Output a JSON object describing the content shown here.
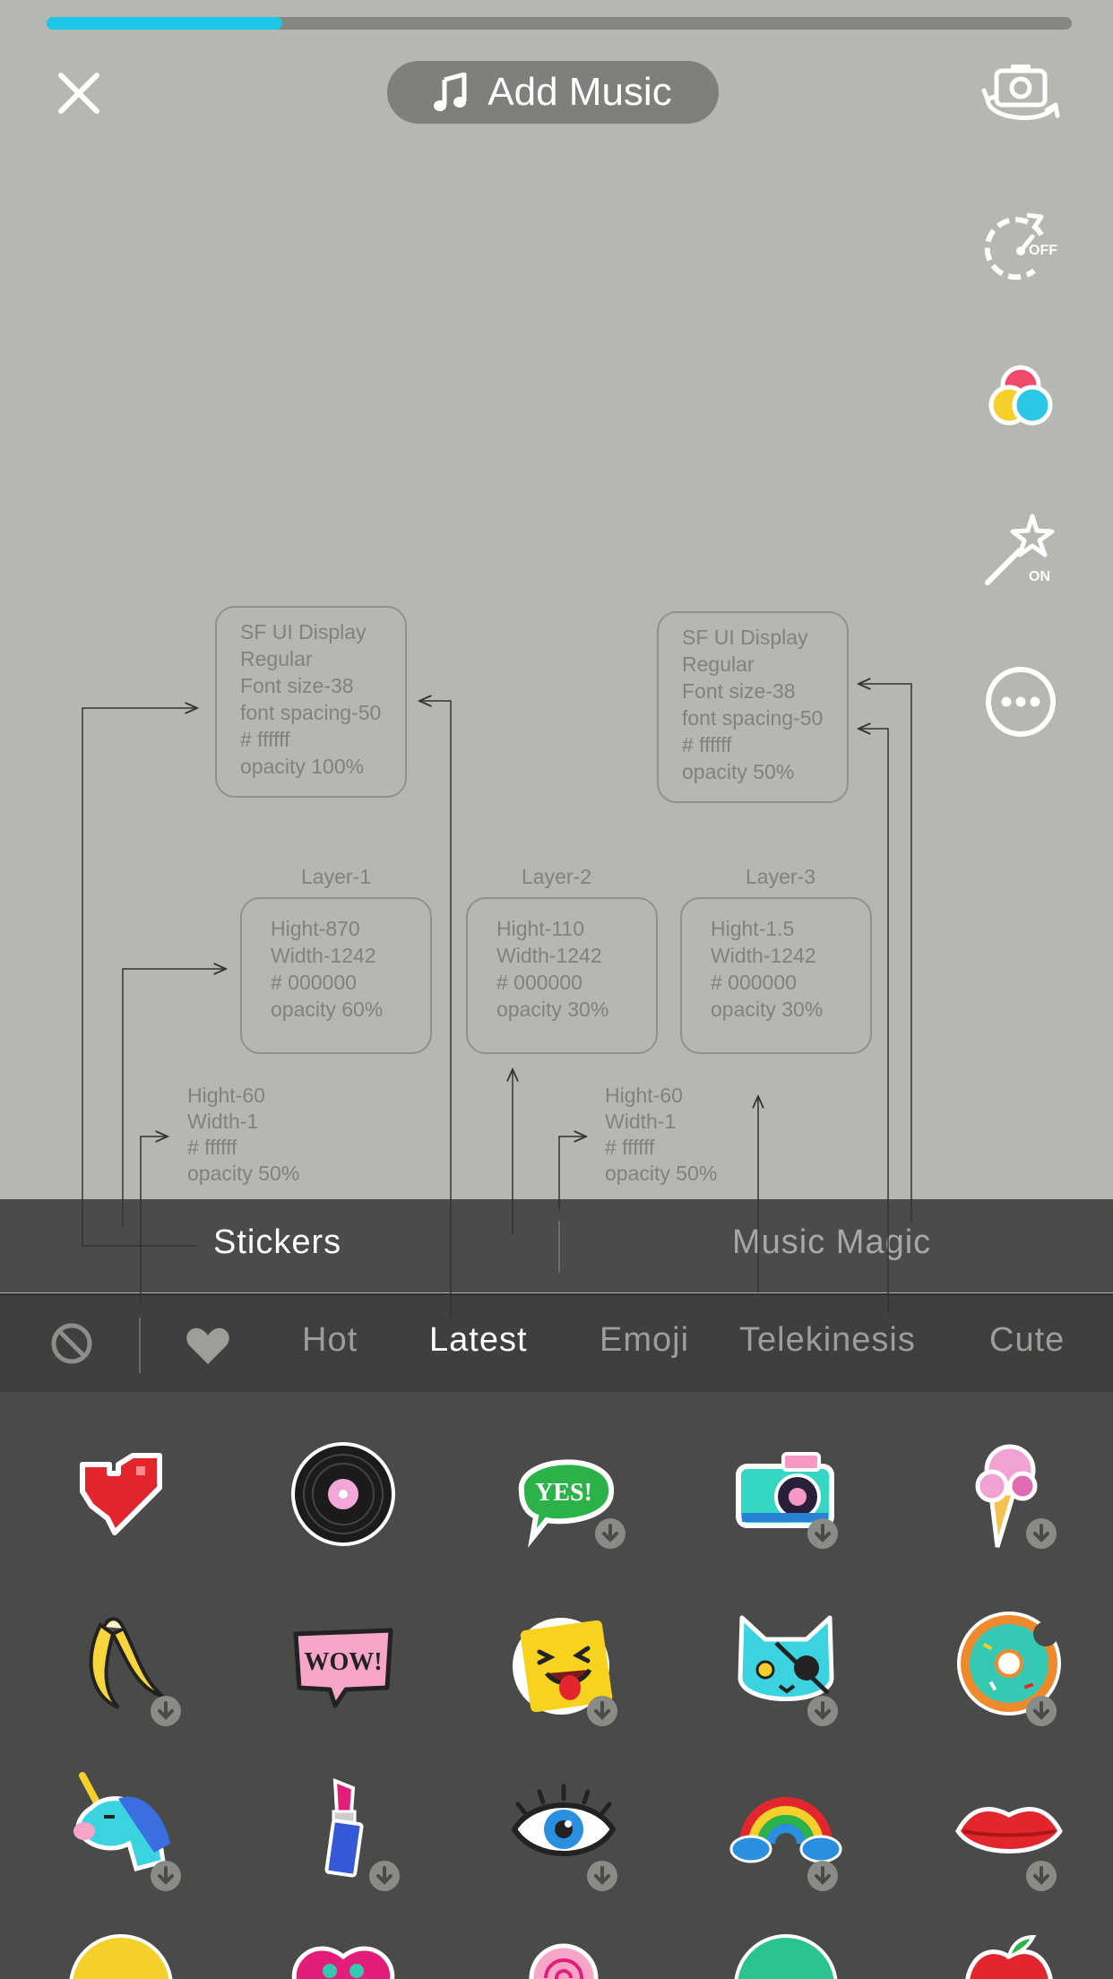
{
  "record": {
    "progress": 0.23,
    "progress_color": "#1bc6e6",
    "add_music_label": "Add Music",
    "side_controls": [
      {
        "icon": "flip-camera-icon"
      },
      {
        "icon": "timer-icon",
        "state": "OFF"
      },
      {
        "icon": "filters-icon"
      },
      {
        "icon": "magic-wand-icon",
        "state": "ON"
      },
      {
        "icon": "more-icon"
      }
    ]
  },
  "spec": {
    "text_white": [
      "SF UI Display",
      "Regular",
      "Font size-38",
      "font spacing-50",
      "# ffffff",
      "opacity 100%"
    ],
    "text_dim": [
      "SF UI Display",
      "Regular",
      "Font size-38",
      "font spacing-50",
      "# ffffff",
      "opacity 50%"
    ],
    "layers": [
      {
        "label": "Layer-1",
        "lines": [
          "Hight-870",
          "Width-1242",
          "# 000000",
          "opacity 60%"
        ]
      },
      {
        "label": "Layer-2",
        "lines": [
          "Hight-110",
          "Width-1242",
          "# 000000",
          "opacity 30%"
        ]
      },
      {
        "label": "Layer-3",
        "lines": [
          "Hight-1.5",
          "Width-1242",
          "# 000000",
          "opacity 30%"
        ]
      }
    ],
    "divider_a": [
      "Hight-60",
      "Width-1",
      "# ffffff",
      "opacity 50%"
    ],
    "divider_b": [
      "Hight-60",
      "Width-1",
      "# ffffff",
      "opacity 50%"
    ]
  },
  "tabs": {
    "left": "Stickers",
    "right": "Music Magic"
  },
  "categories": {
    "none_icon": "none-icon",
    "favorite_icon": "heart-icon",
    "items": [
      "Hot",
      "Latest",
      "Emoji",
      "Telekinesis",
      "Cute"
    ],
    "active": "Latest"
  },
  "stickers": [
    {
      "icon": "pixel-heart-icon",
      "download": false
    },
    {
      "icon": "vinyl-record-icon",
      "download": false
    },
    {
      "icon": "yes-bubble-icon",
      "label": "YES!",
      "download": true
    },
    {
      "icon": "camera-sticker-icon",
      "download": true
    },
    {
      "icon": "ice-cream-icon",
      "download": true
    },
    {
      "icon": "banana-icon",
      "download": true
    },
    {
      "icon": "wow-bubble-icon",
      "label": "WOW!",
      "download": false
    },
    {
      "icon": "tongue-emoji-icon",
      "download": true
    },
    {
      "icon": "pirate-cat-icon",
      "download": true
    },
    {
      "icon": "donut-icon",
      "download": true
    },
    {
      "icon": "unicorn-icon",
      "download": true
    },
    {
      "icon": "lipstick-icon",
      "download": true
    },
    {
      "icon": "eye-icon",
      "download": true
    },
    {
      "icon": "rainbow-icon",
      "download": true
    },
    {
      "icon": "lips-icon",
      "download": true
    }
  ]
}
